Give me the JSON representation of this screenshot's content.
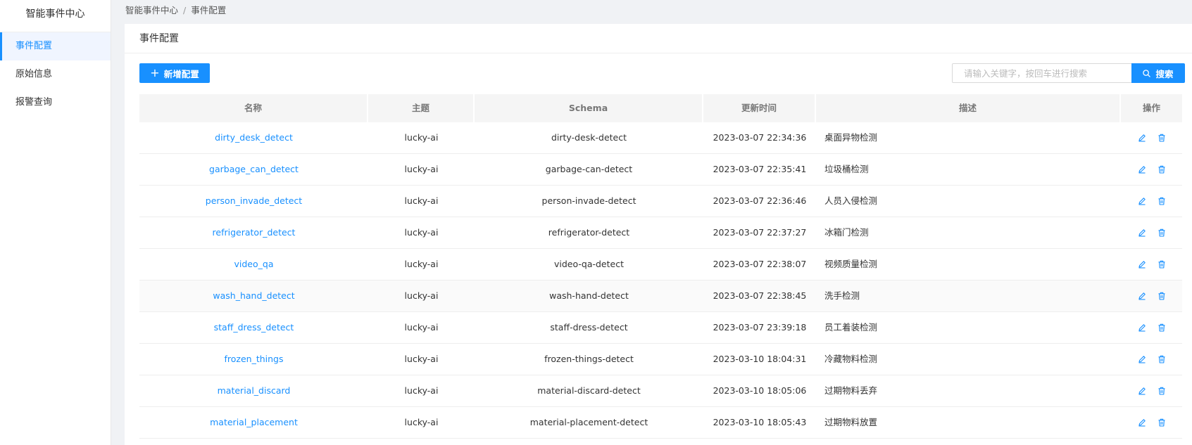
{
  "app": {
    "title": "智能事件中心"
  },
  "sidebar": {
    "items": [
      {
        "label": "事件配置"
      },
      {
        "label": "原始信息"
      },
      {
        "label": "报警查询"
      }
    ]
  },
  "breadcrumb": {
    "root": "智能事件中心",
    "current": "事件配置"
  },
  "page": {
    "title": "事件配置"
  },
  "toolbar": {
    "add_label": "新增配置",
    "search_placeholder": "请输入关键字，按回车进行搜索",
    "search_label": "搜索"
  },
  "table": {
    "headers": [
      "名称",
      "主题",
      "Schema",
      "更新时间",
      "描述",
      "操作"
    ],
    "rows": [
      {
        "name": "dirty_desk_detect",
        "topic": "lucky-ai",
        "schema": "dirty-desk-detect",
        "updated": "2023-03-07 22:34:36",
        "desc": "桌面异物检测"
      },
      {
        "name": "garbage_can_detect",
        "topic": "lucky-ai",
        "schema": "garbage-can-detect",
        "updated": "2023-03-07 22:35:41",
        "desc": "垃圾桶检测"
      },
      {
        "name": "person_invade_detect",
        "topic": "lucky-ai",
        "schema": "person-invade-detect",
        "updated": "2023-03-07 22:36:46",
        "desc": "人员入侵检测"
      },
      {
        "name": "refrigerator_detect",
        "topic": "lucky-ai",
        "schema": "refrigerator-detect",
        "updated": "2023-03-07 22:37:27",
        "desc": "冰箱门检测"
      },
      {
        "name": "video_qa",
        "topic": "lucky-ai",
        "schema": "video-qa-detect",
        "updated": "2023-03-07 22:38:07",
        "desc": "视频质量检测"
      },
      {
        "name": "wash_hand_detect",
        "topic": "lucky-ai",
        "schema": "wash-hand-detect",
        "updated": "2023-03-07 22:38:45",
        "desc": "洗手检测"
      },
      {
        "name": "staff_dress_detect",
        "topic": "lucky-ai",
        "schema": "staff-dress-detect",
        "updated": "2023-03-07 23:39:18",
        "desc": "员工着装检测"
      },
      {
        "name": "frozen_things",
        "topic": "lucky-ai",
        "schema": "frozen-things-detect",
        "updated": "2023-03-10 18:04:31",
        "desc": "冷藏物料检测"
      },
      {
        "name": "material_discard",
        "topic": "lucky-ai",
        "schema": "material-discard-detect",
        "updated": "2023-03-10 18:05:06",
        "desc": "过期物料丢弃"
      },
      {
        "name": "material_placement",
        "topic": "lucky-ai",
        "schema": "material-placement-detect",
        "updated": "2023-03-10 18:05:43",
        "desc": "过期物料放置"
      }
    ]
  },
  "icons": {
    "add": "plus-icon",
    "search": "search-icon",
    "edit": "edit-icon",
    "delete": "delete-icon"
  },
  "colors": {
    "primary": "#1890ff",
    "sidebar_active_bg": "#f0f5ff",
    "header_bg": "#f5f5f5"
  }
}
